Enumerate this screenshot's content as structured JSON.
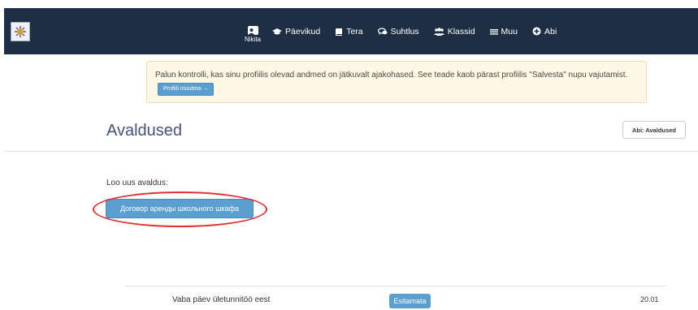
{
  "nav": {
    "profile_name": "Nikita",
    "items": [
      {
        "label": "Päevikud",
        "icon": "graduation-cap-icon"
      },
      {
        "label": "Tera",
        "icon": "book-icon"
      },
      {
        "label": "Suhtlus",
        "icon": "chat-icon"
      },
      {
        "label": "Klassid",
        "icon": "users-icon"
      },
      {
        "label": "Muu",
        "icon": "bars-icon"
      },
      {
        "label": "Abi",
        "icon": "plus-circle-icon"
      }
    ]
  },
  "alert": {
    "message": "Palun kontrolli, kas sinu profiilis olevad andmed on jätkuvalt ajakohased. See teade kaob pärast profiilis \"Salvesta\" nupu vajutamist.",
    "button_label": "Profiili muutma →"
  },
  "page": {
    "title": "Avaldused",
    "help_label": "Abi: Avaldused"
  },
  "create": {
    "label": "Loo uus avaldus:",
    "button_label": "Договор аренды школьного шкафа"
  },
  "applications": [
    {
      "title": "Vaba päev ületunnitöö eest",
      "status": "Esitamata",
      "date": "20.01"
    }
  ],
  "colors": {
    "navbar": "#1e2f45",
    "primary": "#5a9fd0",
    "alert_bg": "#fcf8e3",
    "title": "#45527a",
    "highlight": "#e03030"
  }
}
